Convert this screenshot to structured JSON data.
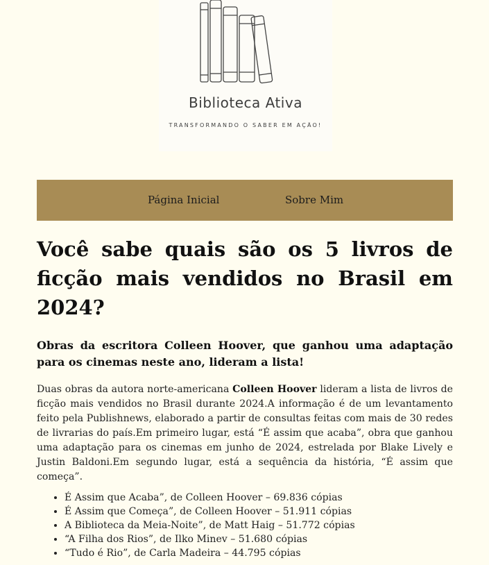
{
  "logo": {
    "title": "Biblioteca Ativa",
    "tagline": "TRANSFORMANDO O SABER EM AÇÃO!"
  },
  "nav": {
    "items": [
      "Página Inicial",
      "Sobre Mim"
    ]
  },
  "article": {
    "headline": "Você sabe quais são os 5 livros de ficção mais vendidos no Brasil em 2024?",
    "subheadline": "Obras da escritora Colleen Hoover, que ganhou uma adaptação para os cinemas neste ano, lideram a lista!",
    "intro_before": "Duas obras da autora norte-americana ",
    "intro_author": "Colleen Hoover",
    "intro_after": " lideram a lista de livros de ficção mais vendidos no Brasil durante 2024.A informação é de um levantamento feito pela Publishnews, elaborado a partir de consultas feitas com mais de 30 redes de livrarias do país.Em primeiro lugar, está “É assim que acaba”, obra que ganhou uma adaptação para os cinemas em junho de 2024, estrelada por Blake Lively e Justin Baldoni.Em segundo lugar, está a sequência da história, “É assim que começa”.",
    "books": [
      "É Assim que Acaba”, de Colleen Hoover – 69.836 cópias",
      "É Assim que Começa”, de Colleen Hoover – 51.911 cópias",
      "A Biblioteca da Meia-Noite”, de Matt Haig – 51.772 cópias",
      "“A Filha dos Rios”, de Ilko Minev – 51.680 cópias",
      "“Tudo é Rio”, de Carla Madeira – 44.795 cópias"
    ]
  }
}
